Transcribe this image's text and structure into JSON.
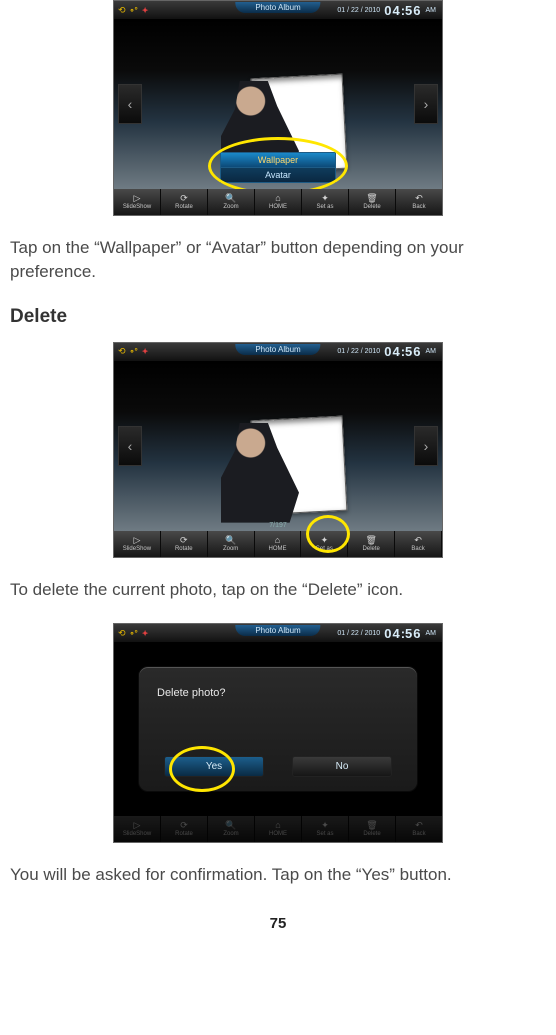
{
  "device_title": "Photo Album",
  "date": "01 / 22 / 2010",
  "clock_h": "04",
  "clock_m": "56",
  "ampm": "AM",
  "popup": {
    "option_selected": "Wallpaper",
    "option_other": "Avatar"
  },
  "toolbar": {
    "slideshow": "SlideShow",
    "rotate": "Rotate",
    "zoom": "Zoom",
    "home": "HOME",
    "setas": "Set as",
    "delete": "Delete",
    "back": "Back"
  },
  "thumb_label": "7/197",
  "para1": "Tap on the “Wallpaper” or “Avatar” button depending on your preference.",
  "section_delete": "Delete",
  "para2": "To delete the current photo, tap on the “Delete” icon.",
  "dialog_q": "Delete photo?",
  "dialog_yes": "Yes",
  "dialog_no": "No",
  "para3": "You will be asked for confirmation. Tap on the “Yes” button.",
  "page_number": "75"
}
